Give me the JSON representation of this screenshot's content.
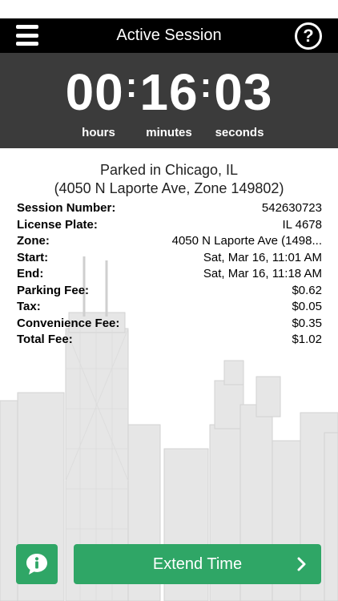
{
  "header": {
    "title": "Active Session"
  },
  "timer": {
    "hours": "00",
    "minutes": "16",
    "seconds": "03",
    "labels": {
      "hours": "hours",
      "minutes": "minutes",
      "seconds": "seconds"
    }
  },
  "location": {
    "line1": "Parked in Chicago, IL",
    "line2": "(4050 N Laporte Ave, Zone 149802)"
  },
  "details": [
    {
      "label": "Session Number:",
      "value": "542630723"
    },
    {
      "label": "License Plate:",
      "value": "IL 4678"
    },
    {
      "label": "Zone:",
      "value": "4050 N Laporte Ave (1498..."
    },
    {
      "label": "Start:",
      "value": "Sat, Mar 16, 11:01 AM"
    },
    {
      "label": "End:",
      "value": "Sat, Mar 16, 11:18 AM"
    },
    {
      "label": "Parking Fee:",
      "value": "$0.62"
    },
    {
      "label": "Tax:",
      "value": "$0.05"
    },
    {
      "label": "Convenience Fee:",
      "value": "$0.35"
    },
    {
      "label": "Total Fee:",
      "value": "$1.02"
    }
  ],
  "actions": {
    "extend_label": "Extend Time"
  },
  "icons": {
    "menu": "menu-icon",
    "help": "help-icon",
    "info": "info-chat-icon",
    "chevron": "chevron-right-icon"
  },
  "colors": {
    "accent": "#2fa666",
    "navbar": "#000000",
    "timer_panel": "#3b3b3b"
  }
}
